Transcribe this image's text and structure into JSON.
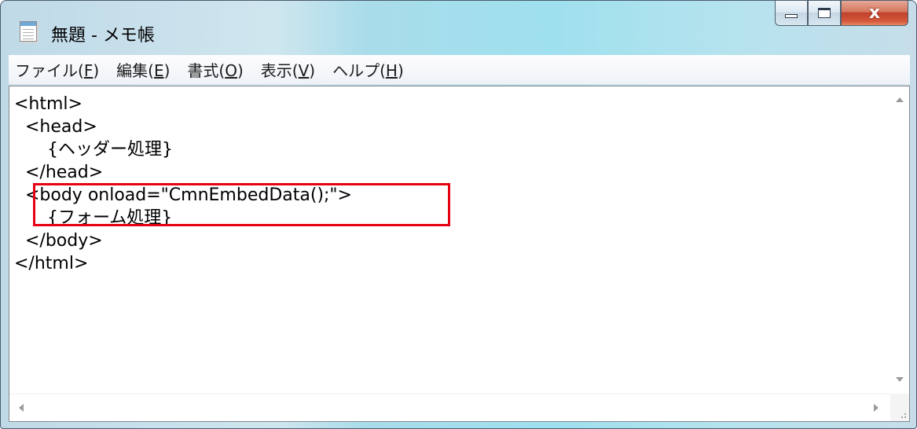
{
  "window": {
    "title": "無題 - メモ帳",
    "close_glyph": "x"
  },
  "menu": [
    {
      "pre": "ファイル(",
      "key": "F",
      "post": ")"
    },
    {
      "pre": "編集(",
      "key": "E",
      "post": ")"
    },
    {
      "pre": "書式(",
      "key": "O",
      "post": ")"
    },
    {
      "pre": "表示(",
      "key": "V",
      "post": ")"
    },
    {
      "pre": "ヘルプ(",
      "key": "H",
      "post": ")"
    }
  ],
  "editor": {
    "lines": [
      "<html>",
      "  <head>",
      "      {ヘッダー処理}",
      "  </head>",
      "  <body onload=\"CmnEmbedData();\">",
      "      {フォーム処理}",
      "  </body>",
      "</html>"
    ],
    "highlight_color": "#e60012"
  },
  "icons": {
    "app": "notepad-icon",
    "minimize": "minimize-icon",
    "maximize": "maximize-icon",
    "close": "close-icon"
  }
}
